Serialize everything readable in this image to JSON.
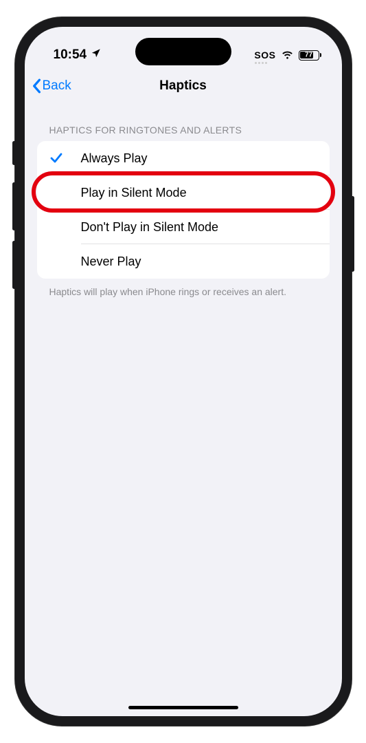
{
  "status_bar": {
    "time": "10:54",
    "sos": "SOS",
    "battery": "77"
  },
  "nav": {
    "back_label": "Back",
    "title": "Haptics"
  },
  "section": {
    "header": "HAPTICS FOR RINGTONES AND ALERTS",
    "footer": "Haptics will play when iPhone rings or receives an alert."
  },
  "options": [
    {
      "label": "Always Play",
      "selected": true,
      "highlighted": false
    },
    {
      "label": "Play in Silent Mode",
      "selected": false,
      "highlighted": true
    },
    {
      "label": "Don't Play in Silent Mode",
      "selected": false,
      "highlighted": false
    },
    {
      "label": "Never Play",
      "selected": false,
      "highlighted": false
    }
  ]
}
